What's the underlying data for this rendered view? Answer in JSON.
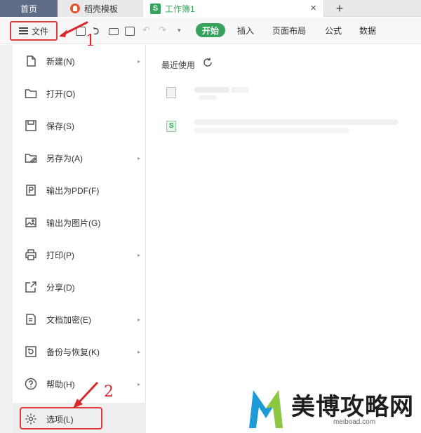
{
  "titlebar": {
    "tabs": [
      {
        "label": "首页"
      },
      {
        "label": "稻壳模板"
      },
      {
        "label": "工作簿1"
      }
    ],
    "close_glyph": "×",
    "add_glyph": "+"
  },
  "toolbar": {
    "file_label": "文件",
    "ribbon_tabs": [
      "开始",
      "插入",
      "页面布局",
      "公式",
      "数据"
    ],
    "active_tab": "开始"
  },
  "file_menu": {
    "items": [
      {
        "label": "新建(N)",
        "icon": "new-file-icon",
        "has_submenu": true
      },
      {
        "label": "打开(O)",
        "icon": "folder-icon",
        "has_submenu": false
      },
      {
        "label": "保存(S)",
        "icon": "save-icon",
        "has_submenu": false
      },
      {
        "label": "另存为(A)",
        "icon": "save-as-icon",
        "has_submenu": true
      },
      {
        "label": "输出为PDF(F)",
        "icon": "pdf-icon",
        "has_submenu": false
      },
      {
        "label": "输出为图片(G)",
        "icon": "image-icon",
        "has_submenu": false
      },
      {
        "label": "打印(P)",
        "icon": "printer-icon",
        "has_submenu": true
      },
      {
        "label": "分享(D)",
        "icon": "share-icon",
        "has_submenu": false
      },
      {
        "label": "文档加密(E)",
        "icon": "lock-document-icon",
        "has_submenu": true
      },
      {
        "label": "备份与恢复(K)",
        "icon": "backup-icon",
        "has_submenu": true
      },
      {
        "label": "帮助(H)",
        "icon": "help-icon",
        "has_submenu": true
      },
      {
        "label": "选项(L)",
        "icon": "gear-icon",
        "has_submenu": false
      }
    ],
    "submenu_glyph": "▸"
  },
  "main": {
    "recent_title": "最近使用"
  },
  "annotations": {
    "step1": "1",
    "step2": "2",
    "color": "#d62a2a"
  },
  "watermark": {
    "text": "美博攻略网",
    "url": "meiboad.com"
  },
  "colors": {
    "accent_green": "#35a35c",
    "annotation_red": "#e03a3a",
    "home_tab": "#5e6c88"
  }
}
